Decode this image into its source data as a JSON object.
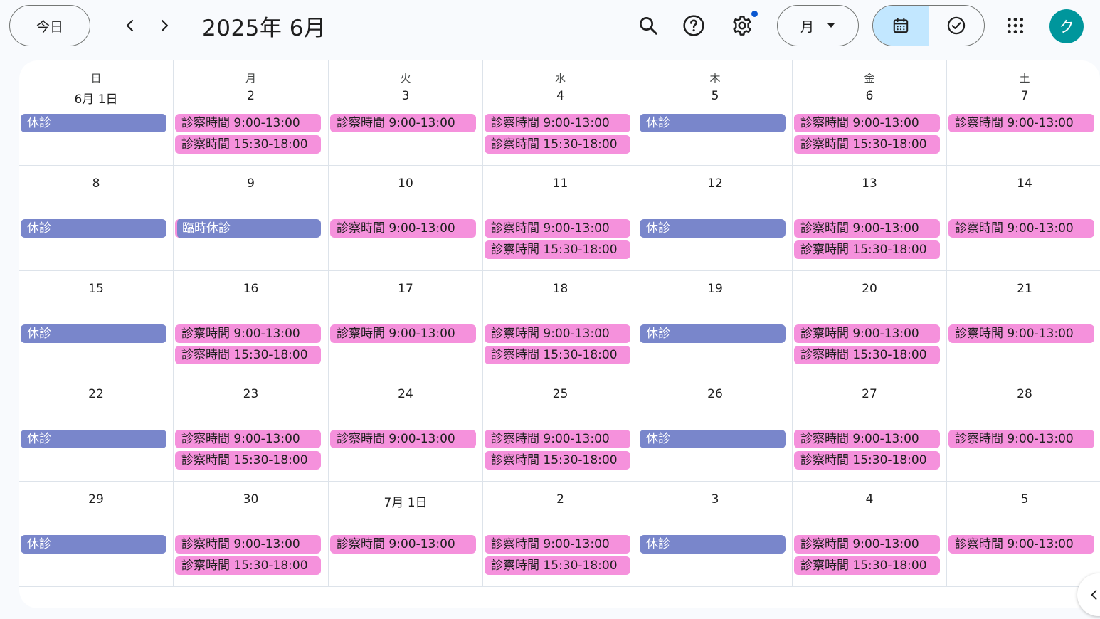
{
  "header": {
    "today_label": "今日",
    "title": "2025年 6月",
    "view_label": "月",
    "avatar_initial": "ク"
  },
  "calendar": {
    "weekdays": [
      "日",
      "月",
      "火",
      "水",
      "木",
      "金",
      "土"
    ],
    "weeks": [
      [
        {
          "label": "6月 1日",
          "events": [
            {
              "text": "休診",
              "kind": "off"
            }
          ]
        },
        {
          "label": "2",
          "events": [
            {
              "text": "診察時間 9:00-13:00",
              "kind": "open"
            },
            {
              "text": "診察時間 15:30-18:00",
              "kind": "open"
            }
          ]
        },
        {
          "label": "3",
          "events": [
            {
              "text": "診察時間 9:00-13:00",
              "kind": "open"
            }
          ]
        },
        {
          "label": "4",
          "events": [
            {
              "text": "診察時間 9:00-13:00",
              "kind": "open"
            },
            {
              "text": "診察時間 15:30-18:00",
              "kind": "open"
            }
          ]
        },
        {
          "label": "5",
          "events": [
            {
              "text": "休診",
              "kind": "off"
            }
          ]
        },
        {
          "label": "6",
          "events": [
            {
              "text": "診察時間 9:00-13:00",
              "kind": "open"
            },
            {
              "text": "診察時間 15:30-18:00",
              "kind": "open"
            }
          ]
        },
        {
          "label": "7",
          "events": [
            {
              "text": "診察時間 9:00-13:00",
              "kind": "open"
            }
          ]
        }
      ],
      [
        {
          "label": "8",
          "events": [
            {
              "text": "休診",
              "kind": "off"
            }
          ]
        },
        {
          "label": "9",
          "events": [
            {
              "text": "臨時休診",
              "kind": "off-special"
            }
          ]
        },
        {
          "label": "10",
          "events": [
            {
              "text": "診察時間 9:00-13:00",
              "kind": "open"
            }
          ]
        },
        {
          "label": "11",
          "events": [
            {
              "text": "診察時間 9:00-13:00",
              "kind": "open"
            },
            {
              "text": "診察時間 15:30-18:00",
              "kind": "open"
            }
          ]
        },
        {
          "label": "12",
          "events": [
            {
              "text": "休診",
              "kind": "off"
            }
          ]
        },
        {
          "label": "13",
          "events": [
            {
              "text": "診察時間 9:00-13:00",
              "kind": "open"
            },
            {
              "text": "診察時間 15:30-18:00",
              "kind": "open"
            }
          ]
        },
        {
          "label": "14",
          "events": [
            {
              "text": "診察時間 9:00-13:00",
              "kind": "open"
            }
          ]
        }
      ],
      [
        {
          "label": "15",
          "events": [
            {
              "text": "休診",
              "kind": "off"
            }
          ]
        },
        {
          "label": "16",
          "events": [
            {
              "text": "診察時間 9:00-13:00",
              "kind": "open"
            },
            {
              "text": "診察時間 15:30-18:00",
              "kind": "open"
            }
          ]
        },
        {
          "label": "17",
          "events": [
            {
              "text": "診察時間 9:00-13:00",
              "kind": "open"
            }
          ]
        },
        {
          "label": "18",
          "events": [
            {
              "text": "診察時間 9:00-13:00",
              "kind": "open"
            },
            {
              "text": "診察時間 15:30-18:00",
              "kind": "open"
            }
          ]
        },
        {
          "label": "19",
          "events": [
            {
              "text": "休診",
              "kind": "off"
            }
          ]
        },
        {
          "label": "20",
          "events": [
            {
              "text": "診察時間 9:00-13:00",
              "kind": "open"
            },
            {
              "text": "診察時間 15:30-18:00",
              "kind": "open"
            }
          ]
        },
        {
          "label": "21",
          "events": [
            {
              "text": "診察時間 9:00-13:00",
              "kind": "open"
            }
          ]
        }
      ],
      [
        {
          "label": "22",
          "events": [
            {
              "text": "休診",
              "kind": "off"
            }
          ]
        },
        {
          "label": "23",
          "events": [
            {
              "text": "診察時間 9:00-13:00",
              "kind": "open"
            },
            {
              "text": "診察時間 15:30-18:00",
              "kind": "open"
            }
          ]
        },
        {
          "label": "24",
          "events": [
            {
              "text": "診察時間 9:00-13:00",
              "kind": "open"
            }
          ]
        },
        {
          "label": "25",
          "events": [
            {
              "text": "診察時間 9:00-13:00",
              "kind": "open"
            },
            {
              "text": "診察時間 15:30-18:00",
              "kind": "open"
            }
          ]
        },
        {
          "label": "26",
          "events": [
            {
              "text": "休診",
              "kind": "off"
            }
          ]
        },
        {
          "label": "27",
          "events": [
            {
              "text": "診察時間 9:00-13:00",
              "kind": "open"
            },
            {
              "text": "診察時間 15:30-18:00",
              "kind": "open"
            }
          ]
        },
        {
          "label": "28",
          "events": [
            {
              "text": "診察時間 9:00-13:00",
              "kind": "open"
            }
          ]
        }
      ],
      [
        {
          "label": "29",
          "events": [
            {
              "text": "休診",
              "kind": "off"
            }
          ]
        },
        {
          "label": "30",
          "events": [
            {
              "text": "診察時間 9:00-13:00",
              "kind": "open"
            },
            {
              "text": "診察時間 15:30-18:00",
              "kind": "open"
            }
          ]
        },
        {
          "label": "7月 1日",
          "events": [
            {
              "text": "診察時間 9:00-13:00",
              "kind": "open"
            }
          ]
        },
        {
          "label": "2",
          "events": [
            {
              "text": "診察時間 9:00-13:00",
              "kind": "open"
            },
            {
              "text": "診察時間 15:30-18:00",
              "kind": "open"
            }
          ]
        },
        {
          "label": "3",
          "events": [
            {
              "text": "休診",
              "kind": "off"
            }
          ]
        },
        {
          "label": "4",
          "events": [
            {
              "text": "診察時間 9:00-13:00",
              "kind": "open"
            },
            {
              "text": "診察時間 15:30-18:00",
              "kind": "open"
            }
          ]
        },
        {
          "label": "5",
          "events": [
            {
              "text": "診察時間 9:00-13:00",
              "kind": "open"
            }
          ]
        }
      ]
    ]
  },
  "colors": {
    "open_event": "#f591dc",
    "off_event": "#7986cb",
    "accent": "#c2e7ff",
    "avatar": "#00969c"
  },
  "icons": {
    "prev": "chevron-left-icon",
    "next": "chevron-right-icon",
    "search": "search-icon",
    "help": "help-icon",
    "settings": "gear-icon",
    "dropdown": "caret-down-icon",
    "calendar_view": "calendar-icon",
    "tasks_view": "check-circle-icon",
    "apps": "apps-grid-icon",
    "side_panel": "chevron-left-icon"
  }
}
